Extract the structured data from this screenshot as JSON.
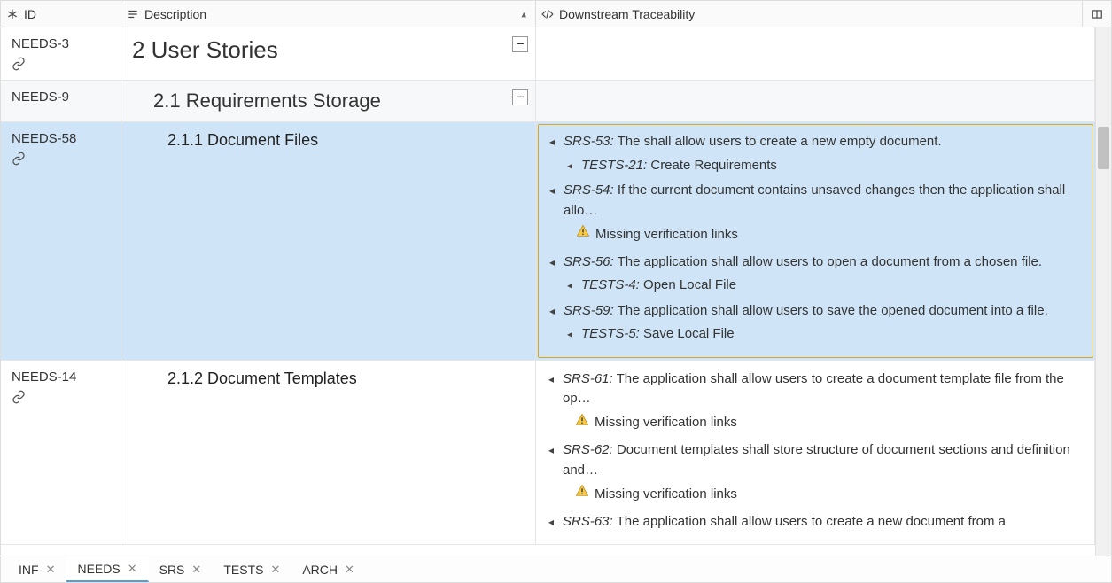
{
  "columns": {
    "id": "ID",
    "description": "Description",
    "traceability": "Downstream Traceability"
  },
  "rows": [
    {
      "id": "NEEDS-3",
      "desc": "2 User Stories",
      "level": "h1",
      "indent": 0,
      "collapsible": true,
      "hasLink": true,
      "trace": []
    },
    {
      "id": "NEEDS-9",
      "desc": "2.1 Requirements Storage",
      "level": "h2",
      "indent": 1,
      "collapsible": true,
      "alt": true,
      "trace": []
    },
    {
      "id": "NEEDS-58",
      "desc": "2.1.1 Document Files",
      "level": "h3",
      "indent": 2,
      "selected": true,
      "hasLink": true,
      "trace": [
        {
          "type": "item",
          "ref": "SRS-53:",
          "text": " The shall allow users to create a new empty document."
        },
        {
          "type": "sub",
          "ref": "TESTS-21:",
          "text": " Create Requirements"
        },
        {
          "type": "item",
          "ref": "SRS-54:",
          "text": " If the current document contains unsaved changes then the application shall allo…"
        },
        {
          "type": "warn",
          "text": "Missing verification links"
        },
        {
          "type": "item",
          "ref": "SRS-56:",
          "text": " The application shall allow users to open a document from a chosen file."
        },
        {
          "type": "sub",
          "ref": "TESTS-4:",
          "text": " Open Local File"
        },
        {
          "type": "item",
          "ref": "SRS-59:",
          "text": " The application shall allow users to save the opened document into a file."
        },
        {
          "type": "sub",
          "ref": "TESTS-5:",
          "text": " Save Local File"
        }
      ]
    },
    {
      "id": "NEEDS-14",
      "desc": "2.1.2 Document Templates",
      "level": "h3",
      "indent": 2,
      "hasLink": true,
      "trace": [
        {
          "type": "item",
          "ref": "SRS-61:",
          "text": " The application shall allow users to create a document template file from the op…"
        },
        {
          "type": "warn",
          "text": "Missing verification links"
        },
        {
          "type": "item",
          "ref": "SRS-62:",
          "text": " Document templates shall store structure of document sections and definition and…"
        },
        {
          "type": "warn",
          "text": "Missing verification links"
        },
        {
          "type": "item",
          "ref": "SRS-63:",
          "text": " The application shall allow users to create a new document from a"
        }
      ]
    }
  ],
  "tabs": [
    {
      "label": "INF",
      "active": false
    },
    {
      "label": "NEEDS",
      "active": true
    },
    {
      "label": "SRS",
      "active": false
    },
    {
      "label": "TESTS",
      "active": false
    },
    {
      "label": "ARCH",
      "active": false
    }
  ],
  "collapse_glyph": "−",
  "warn_label": "Missing verification links"
}
